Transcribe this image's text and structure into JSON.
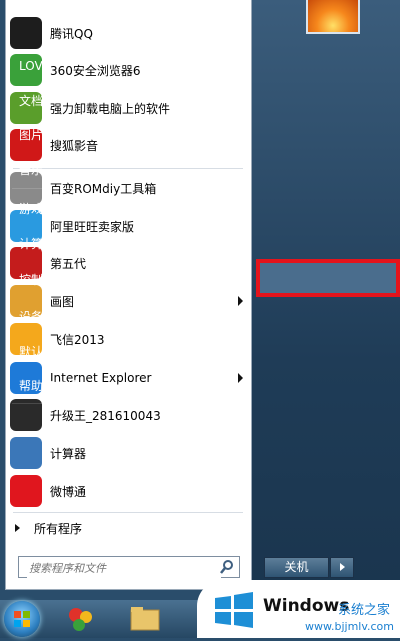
{
  "programs": [
    {
      "label": "腾讯QQ",
      "icon": "qq-penguin-icon",
      "color": "#1d1d1d"
    },
    {
      "label": "360安全浏览器6",
      "icon": "browser-360-icon",
      "color": "#3aa13a"
    },
    {
      "label": "强力卸载电脑上的软件",
      "icon": "uninstall-icon",
      "color": "#5a9e2b"
    },
    {
      "label": "搜狐影音",
      "icon": "sohu-video-icon",
      "color": "#d01818"
    },
    {
      "label": "百变ROMdiy工具箱",
      "icon": "rom-toolbox-icon",
      "color": "#8a8a8a"
    },
    {
      "label": "阿里旺旺卖家版",
      "icon": "aliwangwang-icon",
      "color": "#2a9ae0"
    },
    {
      "label": "第五代",
      "icon": "app-red-icon",
      "color": "#c41c1c"
    },
    {
      "label": "画图",
      "icon": "paint-palette-icon",
      "color": "#e0a030",
      "submenu": true
    },
    {
      "label": "飞信2013",
      "icon": "fetion-icon",
      "color": "#f4a81c"
    },
    {
      "label": "Internet Explorer",
      "icon": "internet-explorer-icon",
      "color": "#1e7ad8",
      "submenu": true
    },
    {
      "label": "升级王_281610043",
      "icon": "upgrade-penguin-icon",
      "color": "#2a2a2a"
    },
    {
      "label": "计算器",
      "icon": "calculator-icon",
      "color": "#3b77b8"
    },
    {
      "label": "微博通",
      "icon": "weibotong-icon",
      "color": "#e0161e"
    }
  ],
  "all_programs": "所有程序",
  "search_placeholder": "搜索程序和文件",
  "right_items": [
    "LOVE",
    "文档",
    "图片",
    "音乐",
    "游戏",
    "计算机",
    "控制面板",
    "设备和打印机",
    "默认程序",
    "帮助和支持"
  ],
  "shutdown_label": "关机",
  "watermark": {
    "brand": "Windows",
    "sub": "系统之家",
    "url": "www.bjjmlv.com"
  }
}
